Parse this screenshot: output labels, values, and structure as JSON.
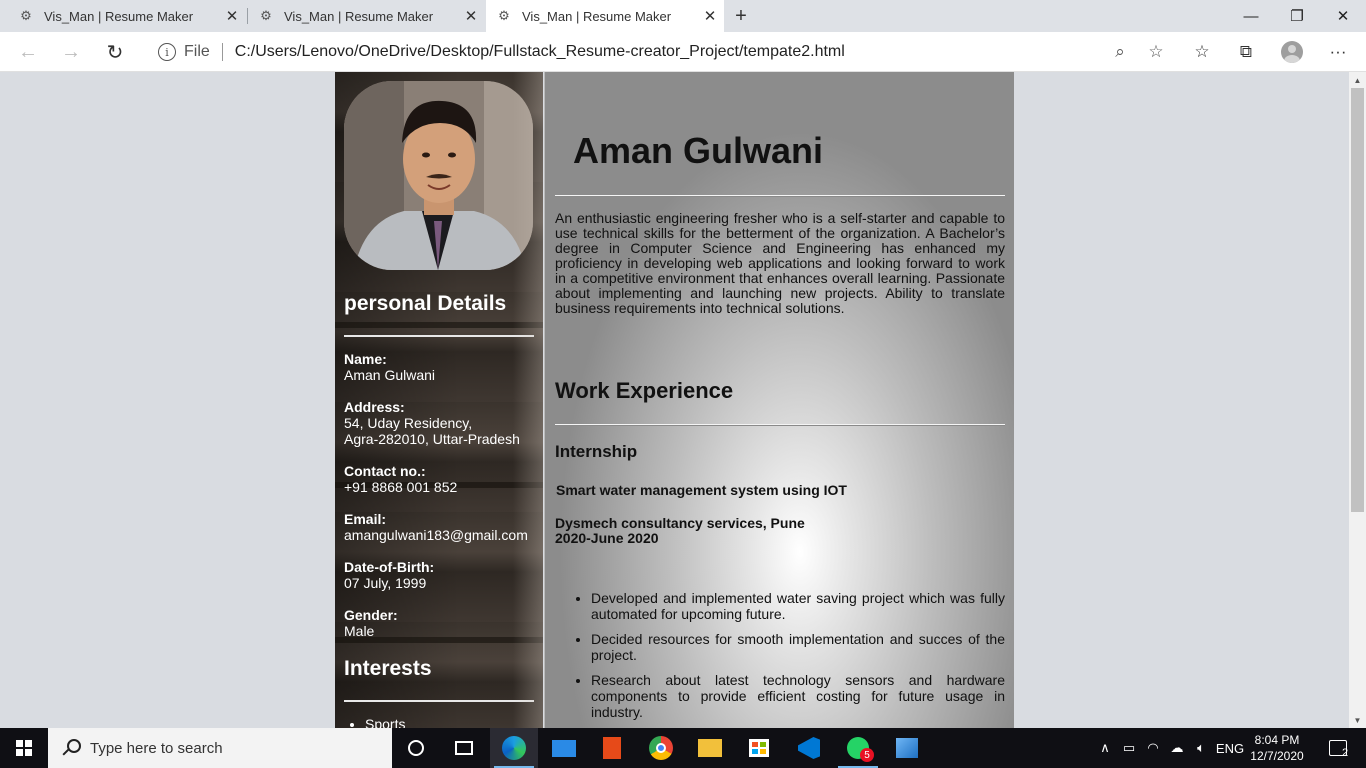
{
  "browser": {
    "tabs": [
      {
        "title": "Vis_Man | Resume Maker",
        "active": false
      },
      {
        "title": "Vis_Man | Resume Maker",
        "active": false
      },
      {
        "title": "Vis_Man | Resume Maker",
        "active": true
      }
    ],
    "close_glyph": "✕",
    "new_tab_glyph": "+",
    "window_controls": {
      "minimize": "—",
      "restore": "❐",
      "close": "✕"
    },
    "nav": {
      "back": "←",
      "forward": "→",
      "refresh": "↻"
    },
    "address": {
      "info_glyph": "i",
      "scheme_label": "File",
      "url": "C:/Users/Lenovo/OneDrive/Desktop/Fullstack_Resume-creator_Project/tempate2.html",
      "zoom_glyph": "⌕",
      "favorite_glyph": "☆"
    },
    "toolbar_icons": {
      "favorites": "☆",
      "collections": "⧉",
      "menu": "···"
    }
  },
  "resume": {
    "sidebar": {
      "personal_heading": "personal Details",
      "details": [
        {
          "label": "Name:",
          "lines": [
            "Aman Gulwani"
          ]
        },
        {
          "label": "Address:",
          "lines": [
            "54, Uday Residency,",
            "Agra-282010, Uttar-Pradesh"
          ]
        },
        {
          "label": "Contact no.:",
          "lines": [
            "+91 8868 001 852"
          ]
        },
        {
          "label": "Email:",
          "lines": [
            "amangulwani183@gmail.com"
          ]
        },
        {
          "label": "Date-of-Birth:",
          "lines": [
            "07 July, 1999"
          ]
        },
        {
          "label": "Gender:",
          "lines": [
            "Male"
          ]
        }
      ],
      "interests_heading": "Interests",
      "interests": [
        "Sports"
      ]
    },
    "main": {
      "name": "Aman Gulwani",
      "summary": "An enthusiastic engineering fresher who is a self-starter and capable to use technical skills for the betterment of the organization. A Bachelor’s degree in Computer Science and Engineering has enhanced my proficiency in developing web applications and looking forward to work in a competitive environment that enhances overall learning. Passionate about implementing and launching new projects. Ability to translate business requirements into technical solutions.",
      "work_heading": "Work Experience",
      "internship_heading": "Internship",
      "project_title": "Smart water management system using IOT",
      "company": "Dysmech consultancy services, Pune",
      "duration": "2020-June 2020",
      "bullets": [
        "Developed and implemented water saving project which was fully automated for upcoming future.",
        "Decided resources for smooth implementation and succes of the project.",
        "Research about latest technology sensors and hardware components to provide efficient costing for future usage in industry."
      ]
    }
  },
  "taskbar": {
    "search_placeholder": "Type here to search",
    "apps": [
      "task-view",
      "edge",
      "mail",
      "office",
      "chrome",
      "file-explorer",
      "store",
      "vscode",
      "whatsapp",
      "photos"
    ],
    "whatsapp_badge": "5",
    "tray": {
      "chevron": "∧",
      "language": "ENG"
    },
    "clock": {
      "time": "8:04 PM",
      "date": "12/7/2020"
    },
    "notification_count": "2"
  },
  "colors": {
    "sidebar_bg": "#3b342e",
    "main_bg_center": "#ffffff",
    "main_bg_edge": "#8c8c8c",
    "accent_blue": "#76b9ed",
    "badge_red": "#e81123"
  }
}
